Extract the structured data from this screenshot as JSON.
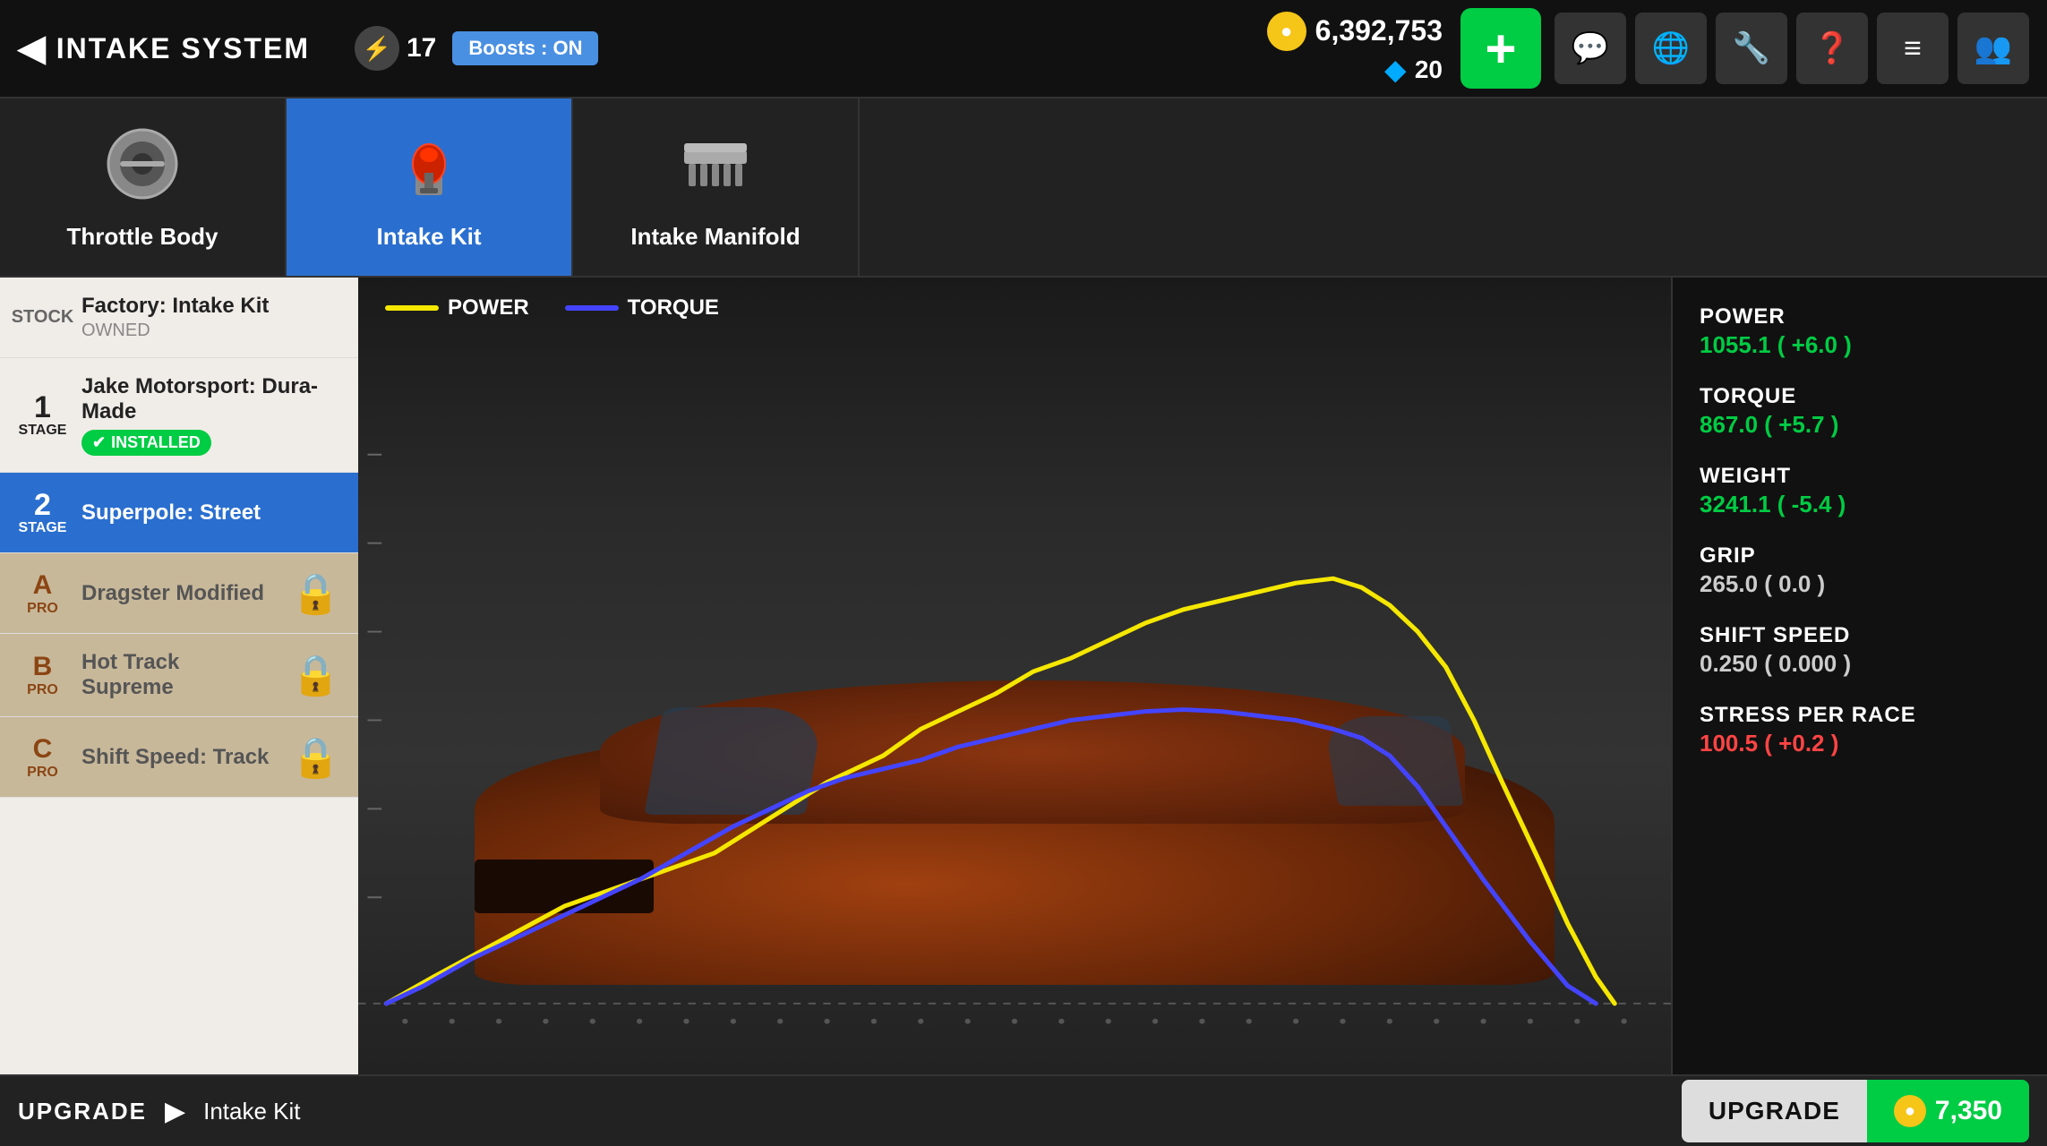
{
  "topNav": {
    "backLabel": "INTAKE SYSTEM",
    "lightningCount": "17",
    "boostsLabel": "Boosts : ON",
    "goldAmount": "6,392,753",
    "diamondAmount": "20",
    "addButtonLabel": "+",
    "navIcons": [
      "💬",
      "🌐",
      "🔧",
      "❓",
      "📋",
      "👥"
    ]
  },
  "partTabs": [
    {
      "id": "throttle-body",
      "label": "Throttle Body",
      "active": false
    },
    {
      "id": "intake-kit",
      "label": "Intake Kit",
      "active": true
    },
    {
      "id": "intake-manifold",
      "label": "Intake Manifold",
      "active": false
    }
  ],
  "upgradeList": [
    {
      "id": "stock",
      "stageLabel": "STOCK",
      "name": "Factory: Intake Kit",
      "sub": "OWNED",
      "status": "owned",
      "locked": false
    },
    {
      "id": "stage1",
      "stageLabel": "1\nSTAGE",
      "name": "Jake Motorsport: Dura-Made",
      "sub": "INSTALLED",
      "status": "installed",
      "locked": false
    },
    {
      "id": "stage2",
      "stageLabel": "2\nSTAGE",
      "name": "Superpole: Street",
      "sub": "",
      "status": "selected",
      "locked": false
    },
    {
      "id": "pro-a",
      "stageLabel": "A\nPRO",
      "name": "Dragster Modified",
      "sub": "",
      "status": "locked",
      "locked": true
    },
    {
      "id": "pro-b",
      "stageLabel": "B\nPRO",
      "name": "Hot Track Supreme",
      "sub": "",
      "status": "locked",
      "locked": true
    },
    {
      "id": "pro-c",
      "stageLabel": "C\nPRO",
      "name": "Shift Speed: Track",
      "sub": "",
      "status": "locked",
      "locked": true
    }
  ],
  "graph": {
    "powerLabel": "POWER",
    "torqueLabel": "TORQUE"
  },
  "stats": {
    "power": {
      "label": "POWER",
      "value": "1055.1 ( +6.0 )",
      "positive": true
    },
    "torque": {
      "label": "TORQUE",
      "value": "867.0 ( +5.7 )",
      "positive": true
    },
    "weight": {
      "label": "WEIGHT",
      "value": "3241.1 ( -5.4 )",
      "positive": true
    },
    "grip": {
      "label": "GRIP",
      "value": "265.0 ( 0.0 )",
      "positive": false
    },
    "shiftSpeed": {
      "label": "SHIFT SPEED",
      "value": "0.250 ( 0.000 )",
      "positive": false
    },
    "stressPerRace": {
      "label": "STRESS PER RACE",
      "value": "100.5 ( +0.2 )",
      "negative": true
    }
  },
  "bottomBar": {
    "upgradeLabel": "UPGRADE",
    "partName": "Intake Kit",
    "upgradeBtnLabel": "UPGRADE",
    "price": "7,350",
    "priceIcon": "💰"
  }
}
